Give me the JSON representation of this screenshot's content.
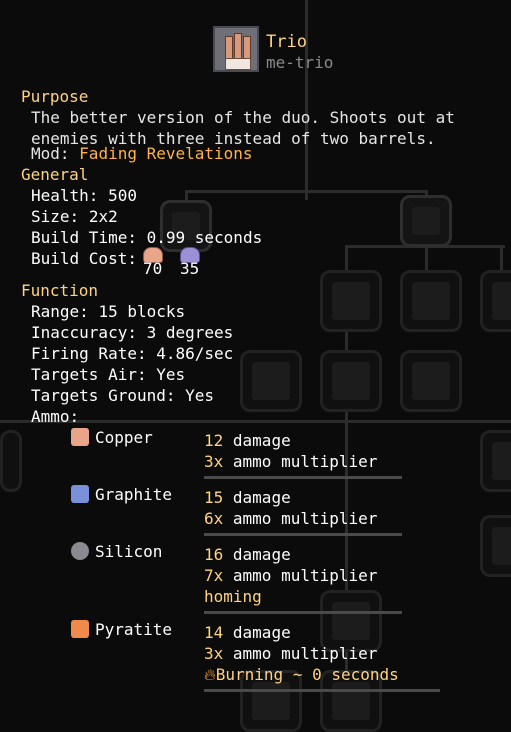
{
  "header": {
    "title": "Trio",
    "internal_name": "me-trio",
    "icon": "trio-turret-icon"
  },
  "purpose": {
    "heading": "Purpose",
    "description": "The better version of the duo. Shoots out at enemies with three instead of two barrels.",
    "mod_label": "Mod:",
    "mod_name": "Fading Revelations"
  },
  "general": {
    "heading": "General",
    "health_label": "Health:",
    "health_value": "500",
    "size_label": "Size:",
    "size_value": "2x2",
    "build_time_label": "Build Time:",
    "build_time_value": "0.99 seconds",
    "build_cost_label": "Build Cost:",
    "costs": [
      {
        "item": "copper",
        "icon": "copper-icon",
        "amount": "70",
        "color": "#e8a58a"
      },
      {
        "item": "lead",
        "icon": "lead-icon",
        "amount": "35",
        "color": "#9b8fd8"
      }
    ]
  },
  "function": {
    "heading": "Function",
    "range_label": "Range:",
    "range_value": "15 blocks",
    "inaccuracy_label": "Inaccuracy:",
    "inaccuracy_value": "3 degrees",
    "firing_rate_label": "Firing Rate:",
    "firing_rate_value": "4.86/sec",
    "targets_air_label": "Targets Air:",
    "targets_air_value": "Yes",
    "targets_ground_label": "Targets Ground:",
    "targets_ground_value": "Yes",
    "ammo_label": "Ammo:"
  },
  "ammo": [
    {
      "name": "Copper",
      "icon": "copper-icon",
      "color": "#e8a58a",
      "damage_num": "12",
      "damage_text": "damage",
      "mult_num": "3x",
      "mult_text": "ammo multiplier",
      "extra": ""
    },
    {
      "name": "Graphite",
      "icon": "graphite-icon",
      "color": "#7a90d8",
      "damage_num": "15",
      "damage_text": "damage",
      "mult_num": "6x",
      "mult_text": "ammo multiplier",
      "extra": ""
    },
    {
      "name": "Silicon",
      "icon": "silicon-icon",
      "color": "#8a8a92",
      "damage_num": "16",
      "damage_text": "damage",
      "mult_num": "7x",
      "mult_text": "ammo multiplier",
      "extra": "homing"
    },
    {
      "name": "Pyratite",
      "icon": "pyratite-icon",
      "color": "#f08a4a",
      "damage_num": "14",
      "damage_text": "damage",
      "mult_num": "3x",
      "mult_text": "ammo multiplier",
      "extra": "Burning ~ 0 seconds"
    }
  ],
  "colors": {
    "accent": "#ffd37f",
    "mod": "#ffb347",
    "background": "#0b0b0b"
  }
}
